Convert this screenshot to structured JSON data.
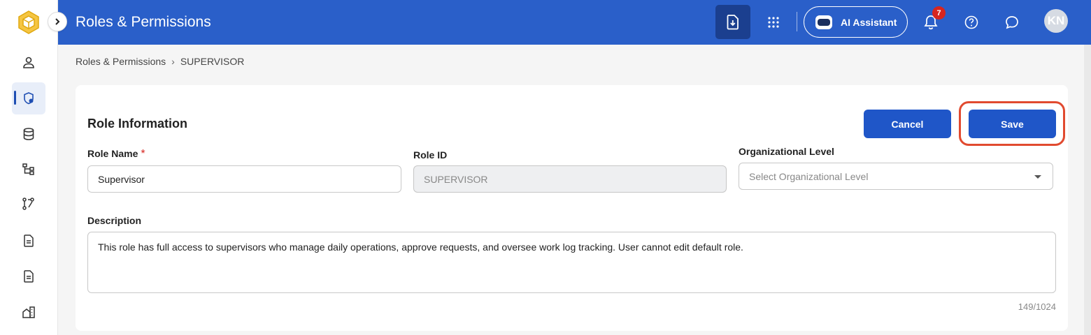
{
  "header": {
    "title": "Roles & Permissions",
    "ai_assistant_label": "AI Assistant",
    "notification_count": "7",
    "avatar_initials": "KN"
  },
  "breadcrumb": {
    "root": "Roles & Permissions",
    "separator": "›",
    "current": "SUPERVISOR"
  },
  "form": {
    "section_title": "Role Information",
    "cancel_label": "Cancel",
    "save_label": "Save",
    "role_name": {
      "label": "Role Name",
      "required_mark": "*",
      "value": "Supervisor"
    },
    "role_id": {
      "label": "Role ID",
      "value": "SUPERVISOR"
    },
    "org_level": {
      "label": "Organizational Level",
      "placeholder": "Select Organizational Level"
    },
    "description": {
      "label": "Description",
      "value": "This role has full access to supervisors who manage daily operations, approve requests, and oversee work log tracking. User cannot edit default role.",
      "counter": "149/1024"
    }
  },
  "sidebar": {
    "icons": [
      "user-icon",
      "shield-icon",
      "database-icon",
      "hierarchy-icon",
      "workflow-icon",
      "document-icon",
      "document-icon",
      "building-icon"
    ],
    "active_index": 1
  },
  "colors": {
    "header_blue": "#2a5fc9",
    "button_blue": "#1f56c8",
    "highlight_red": "#e14a2f",
    "badge_red": "#d7251f"
  }
}
